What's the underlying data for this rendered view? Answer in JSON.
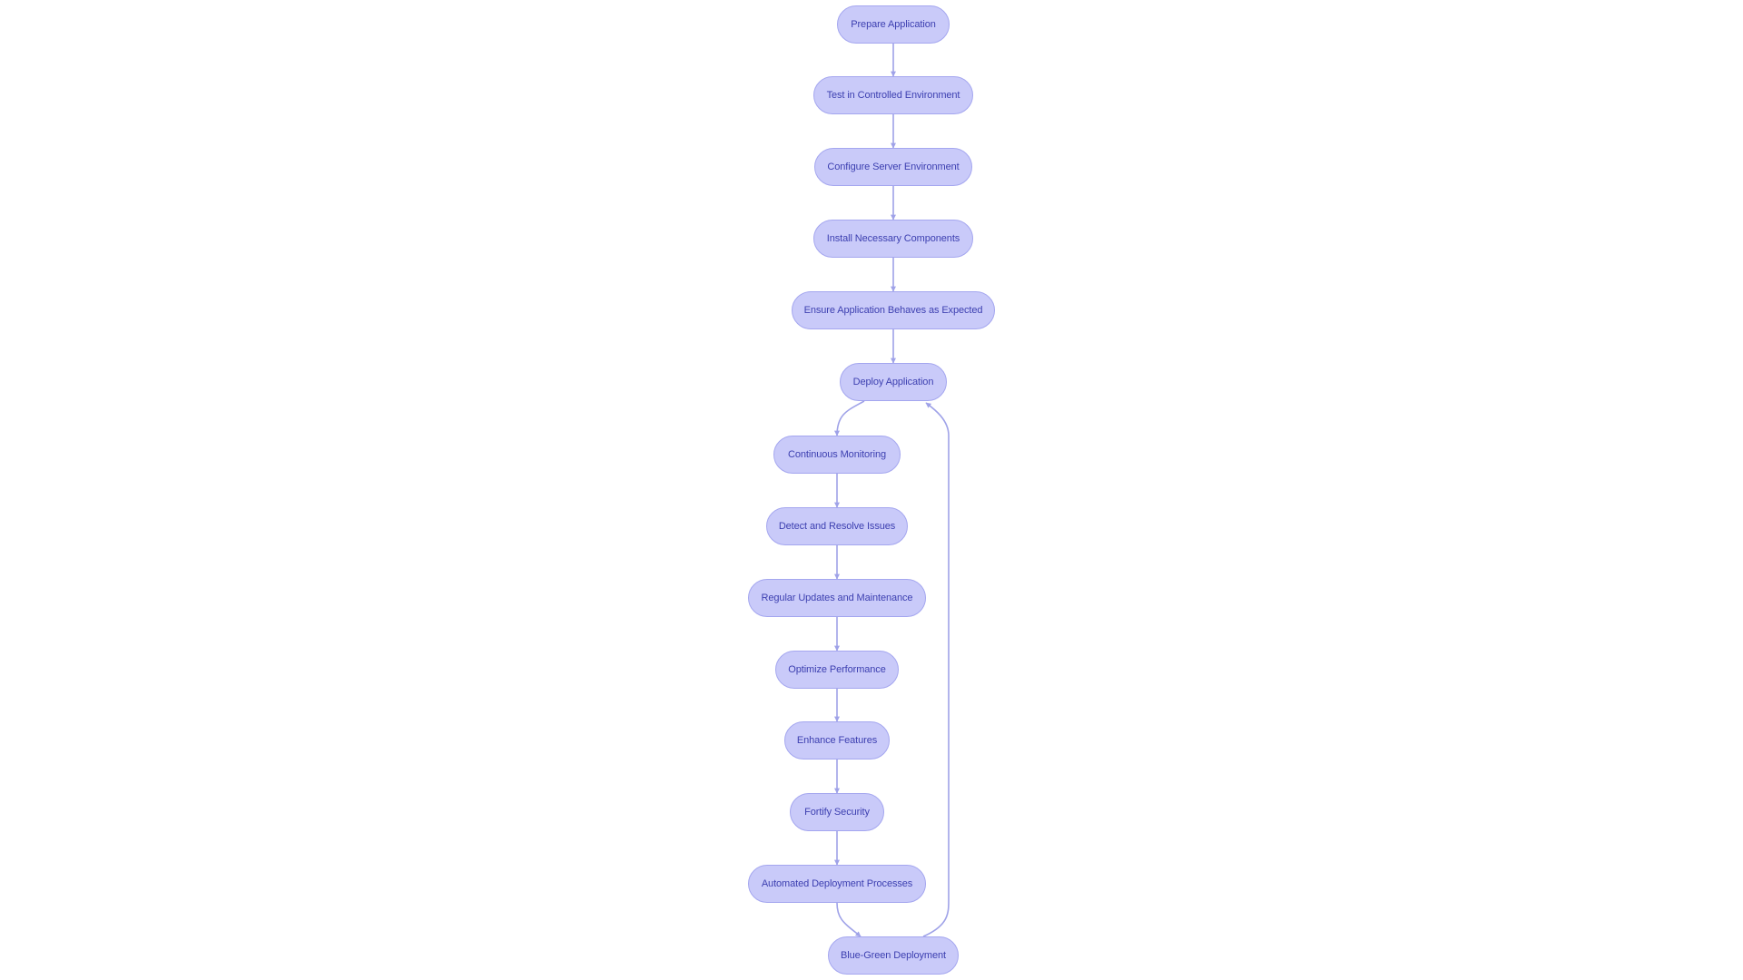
{
  "diagram": {
    "type": "flowchart",
    "direction": "top-to-bottom",
    "colors": {
      "node_fill": "#c9caf9",
      "node_stroke": "#a4a6ef",
      "node_text": "#3c3fb0",
      "edge": "#9fa2e8",
      "background": "#ffffff"
    },
    "nodes": [
      {
        "id": "prepare",
        "label": "Prepare Application"
      },
      {
        "id": "test",
        "label": "Test in Controlled Environment"
      },
      {
        "id": "configure",
        "label": "Configure Server Environment"
      },
      {
        "id": "install",
        "label": "Install Necessary Components"
      },
      {
        "id": "ensure",
        "label": "Ensure Application Behaves as Expected"
      },
      {
        "id": "deploy",
        "label": "Deploy Application"
      },
      {
        "id": "monitor",
        "label": "Continuous Monitoring"
      },
      {
        "id": "detect",
        "label": "Detect and Resolve Issues"
      },
      {
        "id": "updates",
        "label": "Regular Updates and Maintenance"
      },
      {
        "id": "optimize",
        "label": "Optimize Performance"
      },
      {
        "id": "enhance",
        "label": "Enhance Features"
      },
      {
        "id": "fortify",
        "label": "Fortify Security"
      },
      {
        "id": "automated",
        "label": "Automated Deployment Processes"
      },
      {
        "id": "bluegreen",
        "label": "Blue-Green Deployment"
      }
    ],
    "edges": [
      {
        "from": "prepare",
        "to": "test"
      },
      {
        "from": "test",
        "to": "configure"
      },
      {
        "from": "configure",
        "to": "install"
      },
      {
        "from": "install",
        "to": "ensure"
      },
      {
        "from": "ensure",
        "to": "deploy"
      },
      {
        "from": "deploy",
        "to": "monitor"
      },
      {
        "from": "monitor",
        "to": "detect"
      },
      {
        "from": "detect",
        "to": "updates"
      },
      {
        "from": "updates",
        "to": "optimize"
      },
      {
        "from": "optimize",
        "to": "enhance"
      },
      {
        "from": "enhance",
        "to": "fortify"
      },
      {
        "from": "fortify",
        "to": "automated"
      },
      {
        "from": "automated",
        "to": "bluegreen"
      },
      {
        "from": "bluegreen",
        "to": "deploy"
      }
    ]
  }
}
